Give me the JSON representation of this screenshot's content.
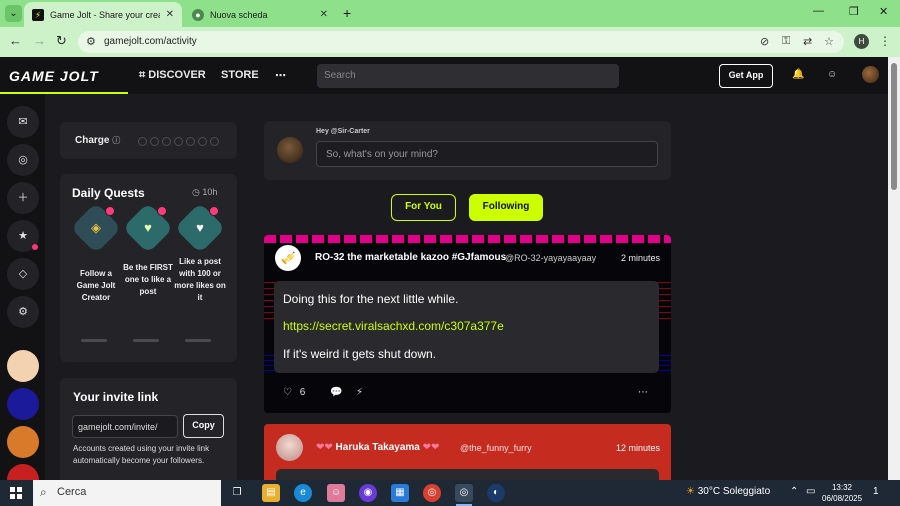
{
  "browser": {
    "tabs": [
      {
        "title": "Game Jolt - Share your creations",
        "active": true
      },
      {
        "title": "Nuova scheda",
        "active": false
      }
    ],
    "url": "gamejolt.com/activity",
    "profile_initial": "H"
  },
  "header": {
    "logo": "GAME JOLT",
    "nav": [
      "DISCOVER",
      "STORE"
    ],
    "search_placeholder": "Search",
    "get_app": "Get App"
  },
  "left": {
    "charge_label": "Charge",
    "daily_quests": {
      "title": "Daily Quests",
      "time": "10h",
      "quests": [
        {
          "text": "Follow a Game Jolt Creator"
        },
        {
          "text": "Be the FIRST one to like a post"
        },
        {
          "text": "Like a post with 100 or more likes on it"
        }
      ]
    },
    "invite": {
      "title": "Your invite link",
      "link_value": "gamejolt.com/invite/",
      "copy_label": "Copy",
      "note": "Accounts created using your invite link automatically become your followers."
    }
  },
  "compose": {
    "hey": "Hey @Sir-Carter",
    "placeholder": "So, what's on your mind?"
  },
  "feed_tabs": {
    "for_you": "For You",
    "following": "Following"
  },
  "posts": [
    {
      "name": "RO-32 the marketable kazoo #GJfamous",
      "handle": "@RO-32-yayayaayaay",
      "time": "2 minutes",
      "lines": [
        "Doing this for the next little while.",
        "https://secret.viralsachxd.com/c307a377e",
        "If it's weird it gets shut down."
      ],
      "likes": "6"
    },
    {
      "name": "Haruka Takayama",
      "handle": "@the_funny_furry",
      "time": "12 minutes"
    }
  ],
  "taskbar": {
    "search": "Cerca",
    "weather": "30°C Soleggiato",
    "time": "13:32",
    "date": "06/08/2025",
    "notifications": "1"
  },
  "colors": {
    "accent": "#ccff00",
    "page_bg": "#1b1b1f",
    "card_bg": "#242428",
    "chrome_green": "#8ee08a",
    "post2_red": "#c52b1f"
  }
}
